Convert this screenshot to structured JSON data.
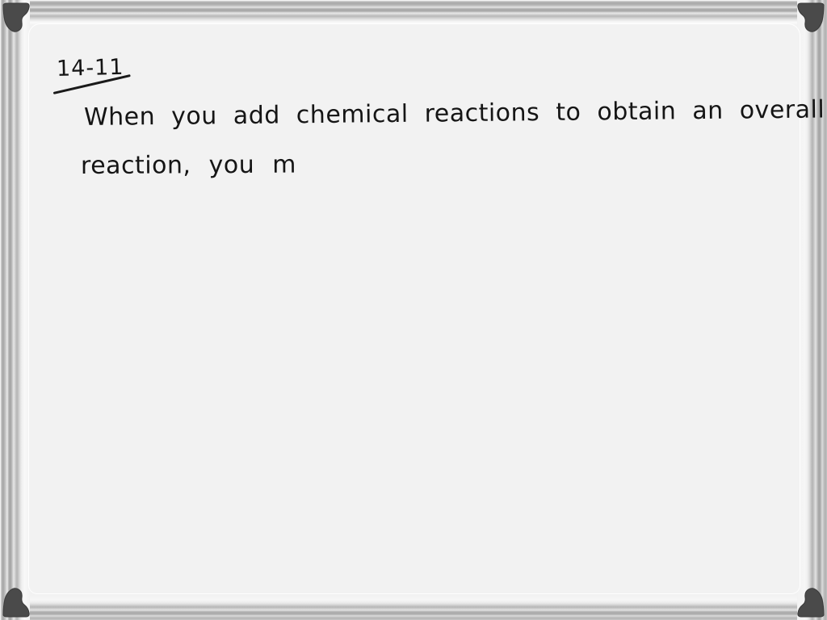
{
  "board": {
    "heading": "14-11",
    "lines": [
      "When you add chemical reactions to  obtain an overall",
      "reaction, you m"
    ],
    "background_color": "#f2f2f2",
    "ink_color": "#151515"
  },
  "frame": {
    "style": "striped-metallic",
    "clips": [
      {
        "name": "top-left-clip"
      },
      {
        "name": "top-right-clip"
      },
      {
        "name": "bottom-left-clip"
      },
      {
        "name": "bottom-right-clip"
      }
    ],
    "clip_color": "#4a4a4a"
  }
}
